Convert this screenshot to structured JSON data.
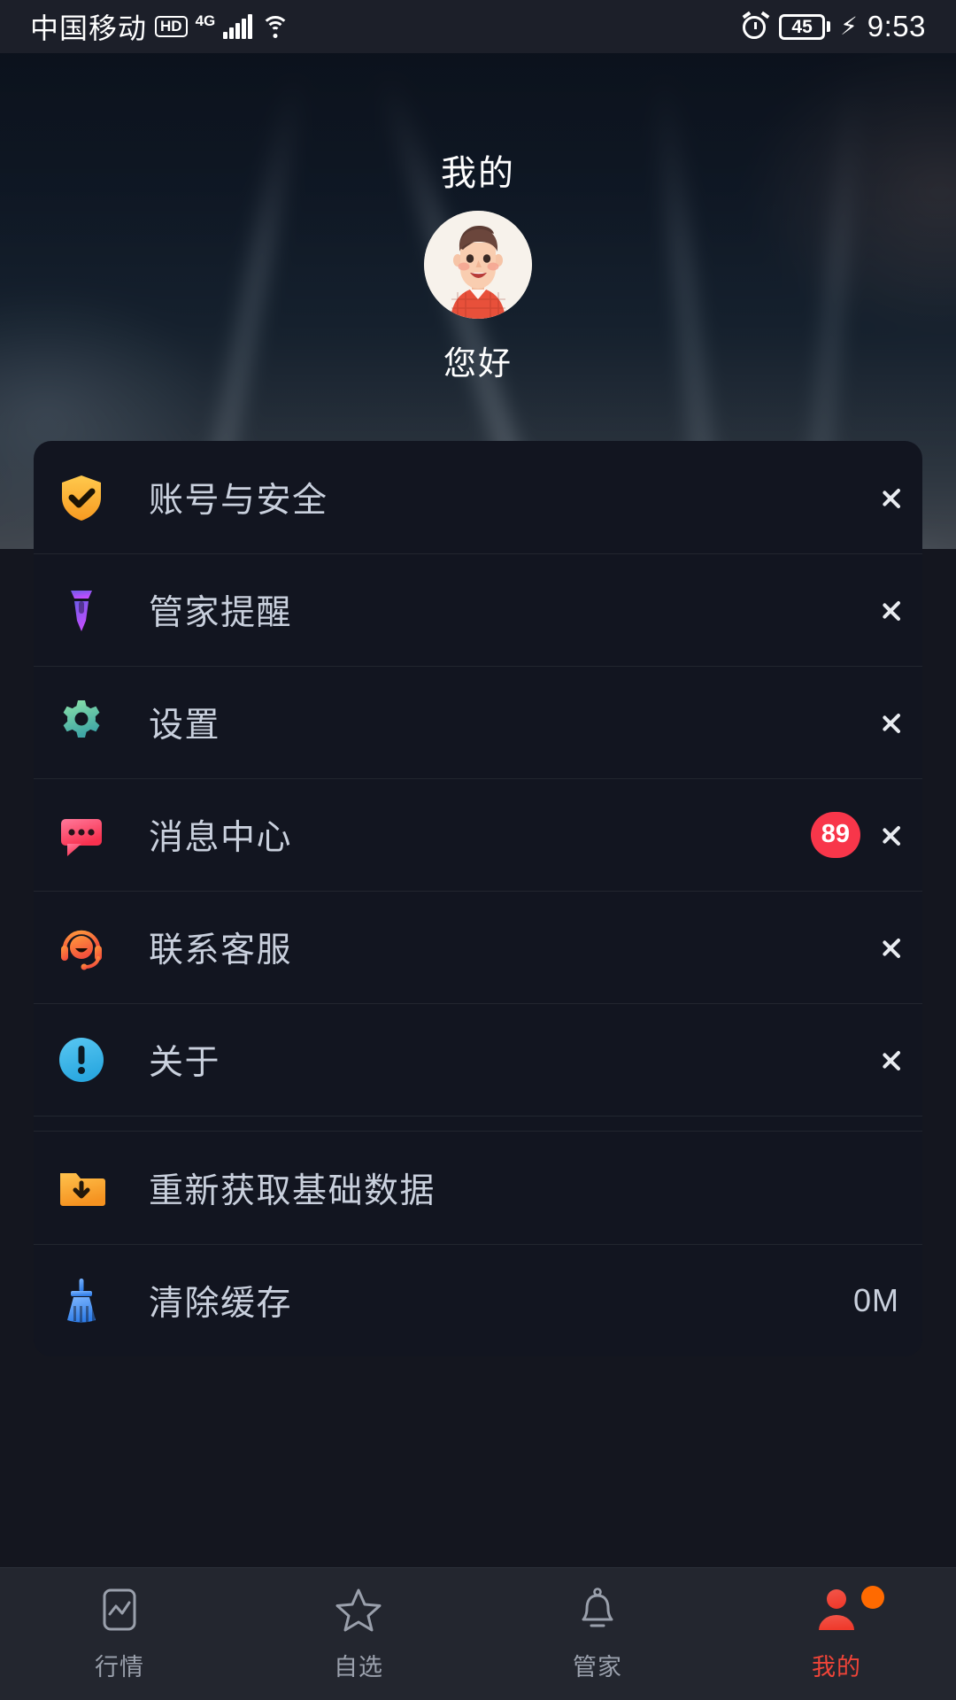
{
  "status_bar": {
    "carrier": "中国移动",
    "hd_label": "HD",
    "network": "4G",
    "signal_icon": "signal-bars-icon",
    "wifi_icon": "wifi-icon",
    "alarm_icon": "alarm-clock-icon",
    "battery_level": "45",
    "charging_icon": "lightning-bolt-icon",
    "time": "9:53"
  },
  "hero": {
    "title": "我的",
    "avatar_icon": "user-avatar",
    "greeting": "您好"
  },
  "menu": {
    "groups": [
      {
        "items": [
          {
            "icon": "shield-check-icon",
            "label": "账号与安全",
            "value": "",
            "badge": "",
            "chevron": true
          },
          {
            "icon": "necktie-icon",
            "label": "管家提醒",
            "value": "",
            "badge": "",
            "chevron": true
          },
          {
            "icon": "gear-icon",
            "label": "设置",
            "value": "",
            "badge": "",
            "chevron": true
          },
          {
            "icon": "message-bubble-icon",
            "label": "消息中心",
            "value": "",
            "badge": "89",
            "chevron": true
          },
          {
            "icon": "headset-icon",
            "label": "联系客服",
            "value": "",
            "badge": "",
            "chevron": true
          },
          {
            "icon": "info-circle-icon",
            "label": "关于",
            "value": "",
            "badge": "",
            "chevron": true
          }
        ]
      },
      {
        "items": [
          {
            "icon": "folder-download-icon",
            "label": "重新获取基础数据",
            "value": "",
            "badge": "",
            "chevron": false
          }
        ]
      },
      {
        "items": [
          {
            "icon": "broom-icon",
            "label": "清除缓存",
            "value": "0M",
            "badge": "",
            "chevron": false
          }
        ]
      }
    ]
  },
  "tabbar": {
    "items": [
      {
        "icon": "market-chart-icon",
        "label": "行情",
        "active": false,
        "dot": false
      },
      {
        "icon": "star-icon",
        "label": "自选",
        "active": false,
        "dot": false
      },
      {
        "icon": "bell-icon",
        "label": "管家",
        "active": false,
        "dot": false
      },
      {
        "icon": "person-icon",
        "label": "我的",
        "active": true,
        "dot": true
      }
    ]
  },
  "colors": {
    "page_bg": "#14161f",
    "card_bg": "#121520",
    "divider": "#22262f",
    "text_primary": "#c9d0dd",
    "badge_red": "#f8364a",
    "tab_active": "#f04438",
    "tab_inactive": "#9aa0ac",
    "tab_dot": "#ff6a00",
    "tabbar_bg": "#23262f"
  }
}
